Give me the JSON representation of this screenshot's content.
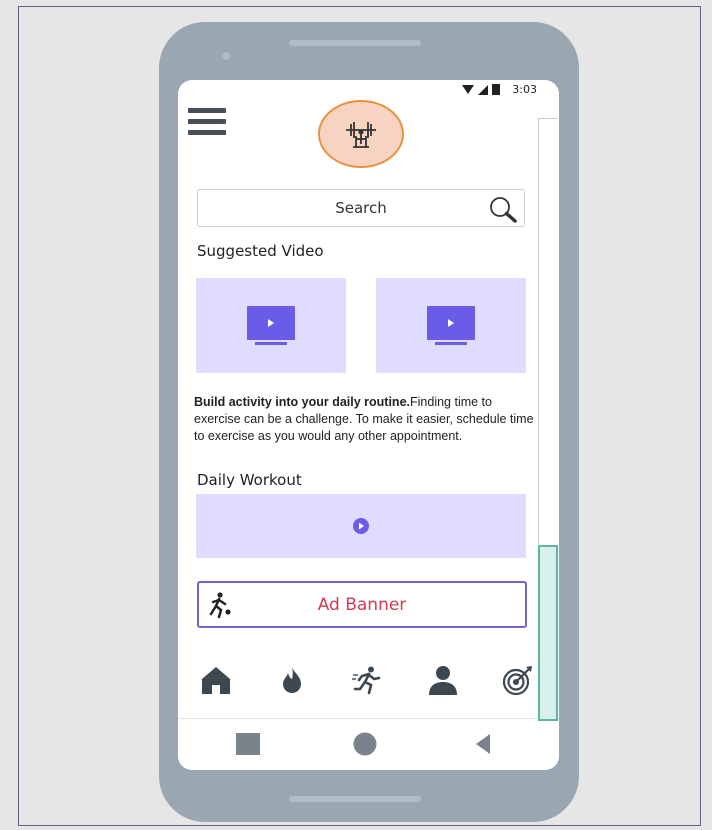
{
  "status": {
    "time": "3:03"
  },
  "search": {
    "label": "Search"
  },
  "sections": {
    "suggested_title": "Suggested Video",
    "daily_title": "Daily Workout"
  },
  "description": {
    "bold": "Build activity into your daily routine.",
    "body": "Finding time to exercise can be a challenge. To make it easier, schedule time to exercise as you would any other appointment."
  },
  "ad": {
    "label": "Ad Banner"
  },
  "nav_icons": [
    "home-icon",
    "flame-icon",
    "running-icon",
    "user-icon",
    "target-icon"
  ],
  "system_icons": [
    "square-icon",
    "circle-icon",
    "back-triangle-icon"
  ],
  "colors": {
    "video_bg": "#dfdcff",
    "accent_purple": "#6b5ce7",
    "ad_text": "#d23b52",
    "ad_border": "#6f66c9",
    "logo_bg": "#f6d4c1",
    "logo_border": "#e8923c",
    "nav_icon": "#3d4750",
    "scroll_thumb": "#d9f0ea"
  }
}
